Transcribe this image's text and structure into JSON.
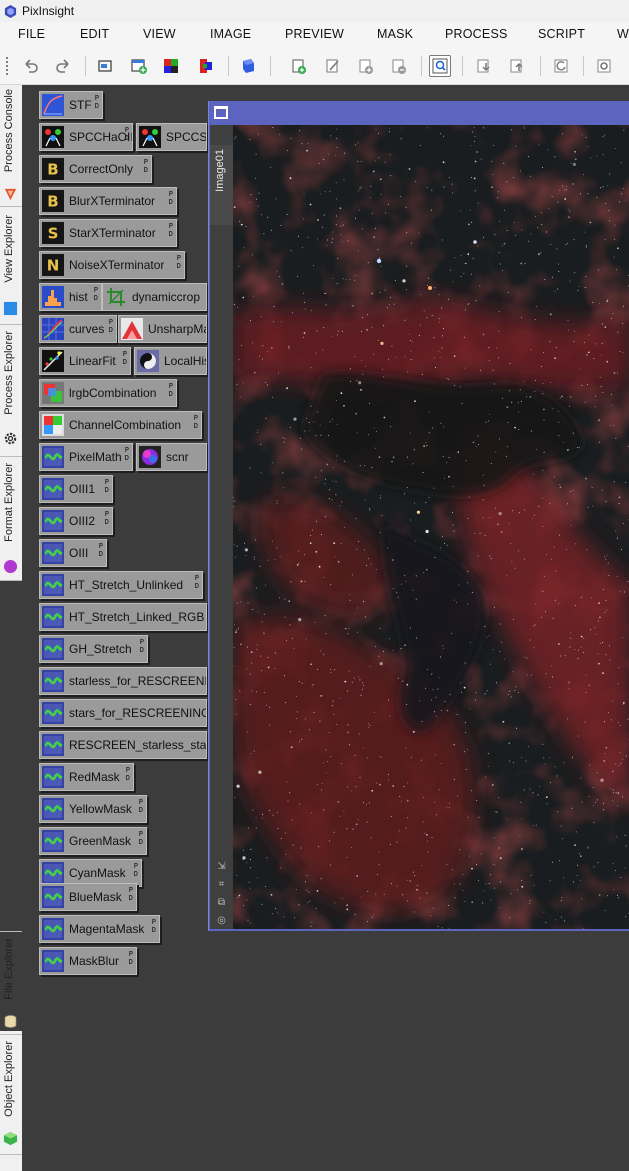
{
  "app": {
    "title": "PixInsight"
  },
  "menu": [
    "FILE",
    "EDIT",
    "VIEW",
    "IMAGE",
    "PREVIEW",
    "MASK",
    "PROCESS",
    "SCRIPT",
    "W"
  ],
  "toolbar": {
    "buttons": [
      "undo-icon",
      "redo-icon",
      "new-window-icon",
      "new-image-icon",
      "channel-icon",
      "split-icon",
      "cube-icon",
      "new-preview-icon",
      "edit-preview-icon",
      "add-preview-icon",
      "add-preview-alt-icon",
      "zoom-readout-icon",
      "import-icon",
      "export-icon",
      "reset-icon",
      "settings-icon"
    ],
    "active": "zoom-readout-icon"
  },
  "sidebar": {
    "tabs": [
      {
        "label": "Process Console",
        "icon": "console-icon"
      },
      {
        "label": "View Explorer",
        "icon": "view-icon"
      },
      {
        "label": "Process Explorer",
        "icon": "gear-icon"
      },
      {
        "label": "Format Explorer",
        "icon": "format-icon"
      },
      {
        "label": "File Explorer",
        "icon": "drive-icon"
      },
      {
        "label": "Object Explorer",
        "icon": "object-icon"
      }
    ]
  },
  "process_icons": [
    {
      "label": "STF",
      "icon": "stf-icon"
    },
    {
      "label": "SPCCHaOII",
      "icon": "spcc-icon"
    },
    {
      "label": "SPCCSI",
      "icon": "spcc-icon"
    },
    {
      "label": "CorrectOnly",
      "icon": "blurx-icon",
      "letter": "B"
    },
    {
      "label": "BlurXTerminator",
      "icon": "blurx-icon",
      "letter": "B"
    },
    {
      "label": "StarXTerminator",
      "icon": "starx-icon",
      "letter": "S"
    },
    {
      "label": "NoiseXTerminator",
      "icon": "noisex-icon",
      "letter": "N"
    },
    {
      "label": "hist",
      "icon": "histogram-icon"
    },
    {
      "label": "dynamiccrop",
      "icon": "crop-icon"
    },
    {
      "label": "curves",
      "icon": "curves-icon"
    },
    {
      "label": "UnsharpMa",
      "icon": "unsharp-icon"
    },
    {
      "label": "LinearFit",
      "icon": "linearfit-icon"
    },
    {
      "label": "LocalHis",
      "icon": "localhist-icon"
    },
    {
      "label": "lrgbCombination",
      "icon": "lrgb-icon"
    },
    {
      "label": "ChannelCombination",
      "icon": "channel-combo-icon"
    },
    {
      "label": "PixelMath",
      "icon": "pixelmath-icon"
    },
    {
      "label": "scnr",
      "icon": "scnr-icon"
    },
    {
      "label": "OIII1",
      "icon": "pixelmath-icon"
    },
    {
      "label": "OIII2",
      "icon": "pixelmath-icon"
    },
    {
      "label": "OIII",
      "icon": "pixelmath-icon"
    },
    {
      "label": "HT_Stretch_Unlinked",
      "icon": "pixelmath-icon"
    },
    {
      "label": "HT_Stretch_Linked_RGB",
      "icon": "pixelmath-icon"
    },
    {
      "label": "GH_Stretch",
      "icon": "pixelmath-icon"
    },
    {
      "label": "starless_for_RESCREENI",
      "icon": "pixelmath-icon"
    },
    {
      "label": "stars_for_RESCREENING",
      "icon": "pixelmath-icon"
    },
    {
      "label": "RESCREEN_starless_star",
      "icon": "pixelmath-icon"
    },
    {
      "label": "RedMask",
      "icon": "pixelmath-icon"
    },
    {
      "label": "YellowMask",
      "icon": "pixelmath-icon"
    },
    {
      "label": "GreenMask",
      "icon": "pixelmath-icon"
    },
    {
      "label": "CyanMask",
      "icon": "pixelmath-icon"
    },
    {
      "label": "BlueMask",
      "icon": "pixelmath-icon"
    },
    {
      "label": "MagentaMask",
      "icon": "pixelmath-icon"
    },
    {
      "label": "MaskBlur",
      "icon": "pixelmath-icon"
    }
  ],
  "icon_flag": "P\nD",
  "image_window": {
    "view_id": "Image01",
    "side_icons": [
      "fit-icon",
      "center-icon",
      "clone-icon",
      "target-icon"
    ],
    "photo": "emission nebula star field"
  },
  "colors": {
    "accent": "#5b65c0",
    "workspace": "#3c3c3c",
    "icon_bg": "#9a9a9a"
  }
}
